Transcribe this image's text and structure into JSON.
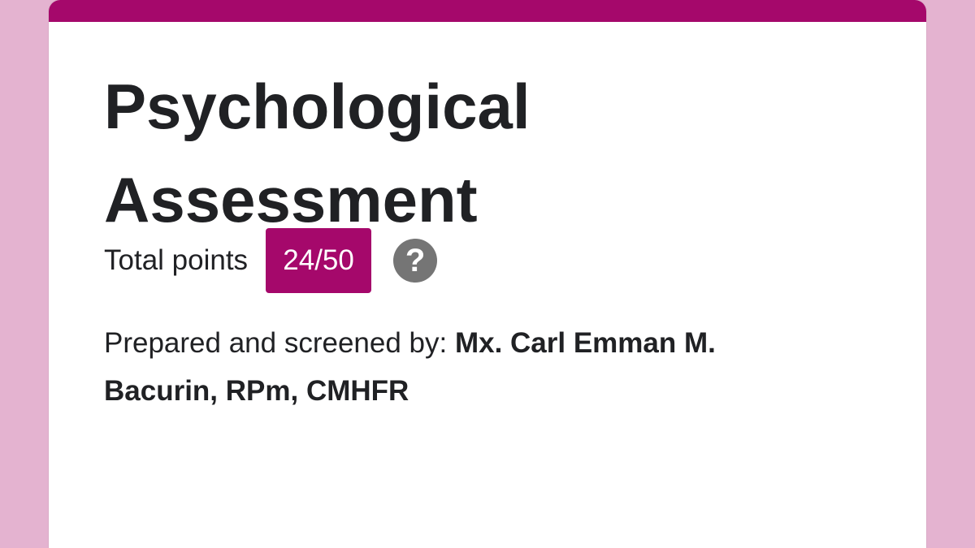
{
  "form": {
    "title": "Psychological Assessment",
    "points_label": "Total points",
    "score": "24/50",
    "help_icon": "question-mark-icon",
    "prepared_prefix": "Prepared and screened by: ",
    "prepared_name": "Mx. Carl Emman M. Bacurin, RPm, CMHFR"
  },
  "colors": {
    "accent": "#a5086b",
    "background": "#e4b3d0",
    "card": "#ffffff",
    "text": "#202124",
    "help_icon": "#757575"
  }
}
